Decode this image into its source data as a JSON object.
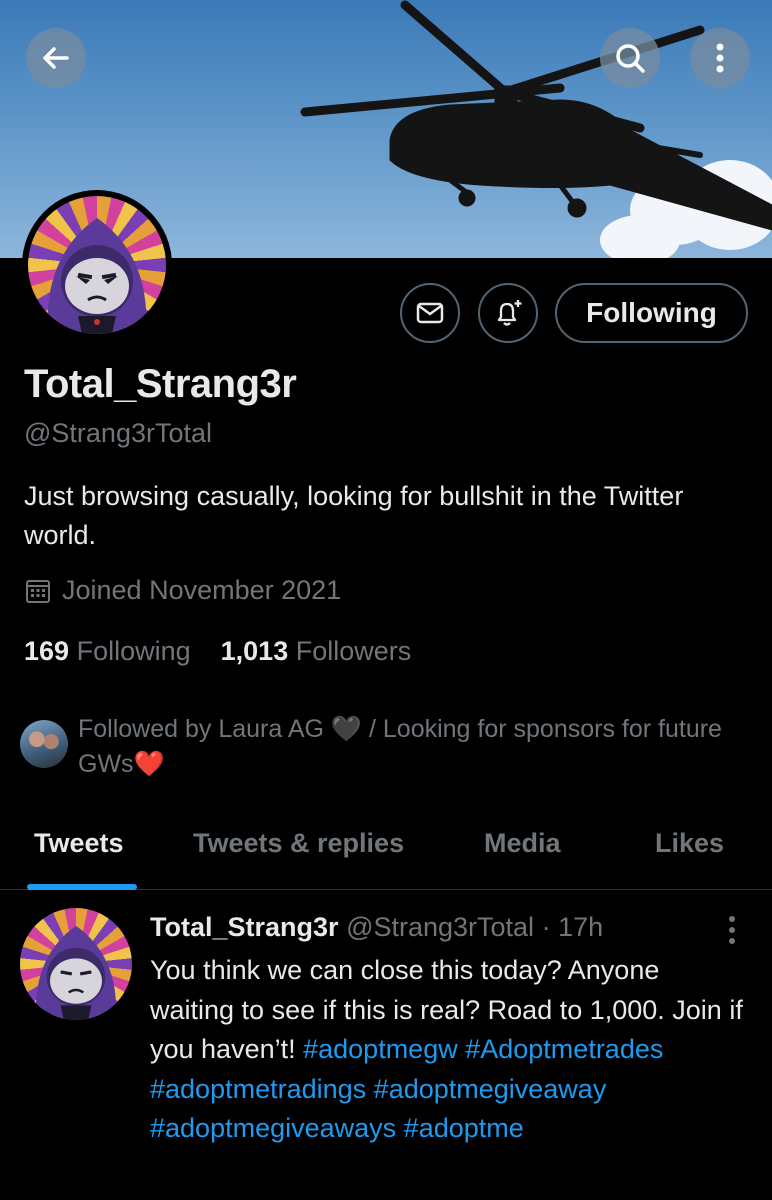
{
  "profile": {
    "display_name": "Total_Strang3r",
    "handle": "@Strang3rTotal",
    "bio": "Just browsing casually, looking for bullshit in the Twitter world.",
    "joined": "Joined November 2021",
    "following_count": "169",
    "following_label": "Following",
    "followers_count": "1,013",
    "followers_label": "Followers",
    "followed_by_text": "Followed by Laura AG 🖤 / Looking for sponsors for future GWs❤️"
  },
  "actions": {
    "following_button": "Following"
  },
  "tabs": [
    {
      "label": "Tweets",
      "active": true
    },
    {
      "label": "Tweets & replies",
      "active": false
    },
    {
      "label": "Media",
      "active": false
    },
    {
      "label": "Likes",
      "active": false
    }
  ],
  "tweet": {
    "author_name": "Total_Strang3r",
    "author_handle": "@Strang3rTotal",
    "separator": " · ",
    "time": "17h",
    "text_line1": "You think we can close this today? Anyone waiting to see if this is real? Road to 1,000. Join if you haven’t! ",
    "hashtags": [
      "#adoptmegw",
      "#Adoptmetrades",
      "#adoptmetradings",
      "#adoptmegiveaway",
      "#adoptmegiveaways",
      "#adoptme"
    ]
  },
  "icons": {
    "back": "back-arrow-icon",
    "search": "search-icon",
    "more": "more-vertical-icon",
    "message": "envelope-icon",
    "notify": "bell-plus-icon",
    "calendar": "calendar-icon"
  },
  "colors": {
    "accent": "#1d9bf0",
    "background": "#000000",
    "text_primary": "#e7e9ea",
    "text_secondary": "#71767b"
  }
}
